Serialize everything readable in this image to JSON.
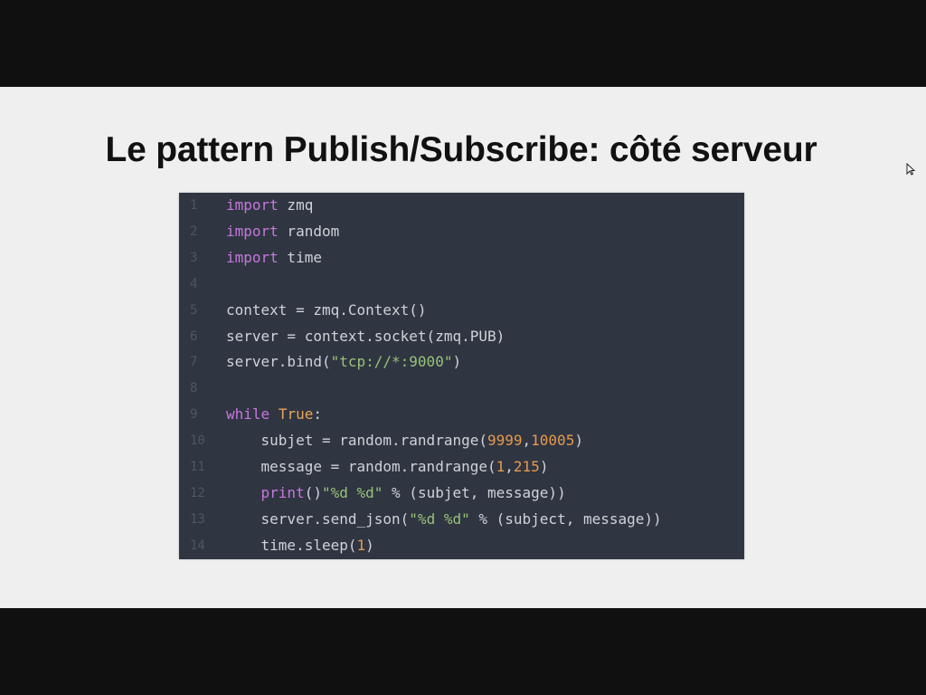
{
  "slide": {
    "title": "Le pattern Publish/Subscribe: côté serveur"
  },
  "code": {
    "lines": [
      {
        "n": "1",
        "parts": [
          {
            "t": "import",
            "c": "kw"
          },
          {
            "t": " zmq",
            "c": ""
          }
        ]
      },
      {
        "n": "2",
        "parts": [
          {
            "t": "import",
            "c": "kw"
          },
          {
            "t": " random",
            "c": ""
          }
        ]
      },
      {
        "n": "3",
        "parts": [
          {
            "t": "import",
            "c": "kw"
          },
          {
            "t": " time",
            "c": ""
          }
        ]
      },
      {
        "n": "4",
        "parts": []
      },
      {
        "n": "5",
        "parts": [
          {
            "t": "context = zmq.Context()",
            "c": ""
          }
        ]
      },
      {
        "n": "6",
        "parts": [
          {
            "t": "server = context.socket(zmq.PUB)",
            "c": ""
          }
        ]
      },
      {
        "n": "7",
        "parts": [
          {
            "t": "server.bind(",
            "c": ""
          },
          {
            "t": "\"tcp://*:9000\"",
            "c": "str"
          },
          {
            "t": ")",
            "c": ""
          }
        ]
      },
      {
        "n": "8",
        "parts": []
      },
      {
        "n": "9",
        "parts": [
          {
            "t": "while",
            "c": "kw"
          },
          {
            "t": " ",
            "c": ""
          },
          {
            "t": "True",
            "c": "bi"
          },
          {
            "t": ":",
            "c": ""
          }
        ]
      },
      {
        "n": "10",
        "parts": [
          {
            "t": "    subjet = random.randrange(",
            "c": ""
          },
          {
            "t": "9999",
            "c": "num"
          },
          {
            "t": ",",
            "c": ""
          },
          {
            "t": "10005",
            "c": "num"
          },
          {
            "t": ")",
            "c": ""
          }
        ]
      },
      {
        "n": "11",
        "parts": [
          {
            "t": "    message = random.randrange(",
            "c": ""
          },
          {
            "t": "1",
            "c": "num"
          },
          {
            "t": ",",
            "c": ""
          },
          {
            "t": "215",
            "c": "num"
          },
          {
            "t": ")",
            "c": ""
          }
        ]
      },
      {
        "n": "12",
        "parts": [
          {
            "t": "    ",
            "c": ""
          },
          {
            "t": "print",
            "c": "kw"
          },
          {
            "t": "()",
            "c": ""
          },
          {
            "t": "\"%d %d\"",
            "c": "str"
          },
          {
            "t": " % (subjet, message))",
            "c": ""
          }
        ]
      },
      {
        "n": "13",
        "parts": [
          {
            "t": "    server.send_json(",
            "c": ""
          },
          {
            "t": "\"%d %d\"",
            "c": "str"
          },
          {
            "t": " % (subject, message))",
            "c": ""
          }
        ]
      },
      {
        "n": "14",
        "parts": [
          {
            "t": "    time.sleep(",
            "c": ""
          },
          {
            "t": "1",
            "c": "num"
          },
          {
            "t": ")",
            "c": ""
          }
        ]
      }
    ]
  },
  "colors": {
    "code_background": "#2f3541",
    "keyword": "#c678dd",
    "string": "#98c379",
    "number": "#e59a4f",
    "builtin": "#e5a55a",
    "line_number": "#4f5663",
    "slide_background": "#efefef"
  },
  "icons": {
    "pointer": "mouse-cursor-icon"
  }
}
